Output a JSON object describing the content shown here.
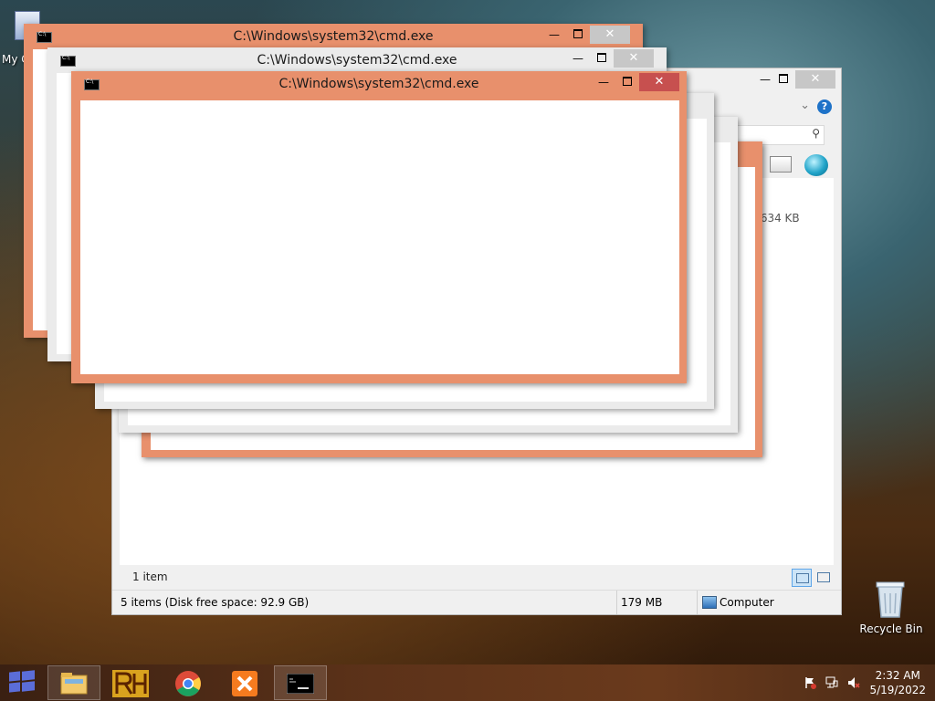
{
  "desktop": {
    "left_icon_label": "My C",
    "recycle_bin_label": "Recycle Bin"
  },
  "explorer": {
    "file_size_text": ",634 KB",
    "items_count": "1 item",
    "help_glyph": "?",
    "status": {
      "summary": "5 items (Disk free space: 92.9 GB)",
      "size": "179 MB",
      "location": "Computer"
    }
  },
  "cmd_windows": [
    {
      "title": "C:\\Windows\\system32\\cmd.exe"
    },
    {
      "title": "C:\\Windows\\system32\\cmd.exe"
    },
    {
      "title": "C:\\Windows\\system32\\cmd.exe"
    }
  ],
  "caption": {
    "minimize": "—",
    "close": "✕"
  },
  "taskbar": {
    "apps": [
      "start-button",
      "file-explorer",
      "rh-app",
      "chrome",
      "xampp",
      "command-prompt"
    ],
    "time": "2:32 AM",
    "date": "5/19/2022"
  },
  "colors": {
    "active_frame": "#e8906c",
    "inactive_frame": "#ebebeb",
    "close_active": "#c7504f",
    "start_logo": "#5b6dd8"
  }
}
